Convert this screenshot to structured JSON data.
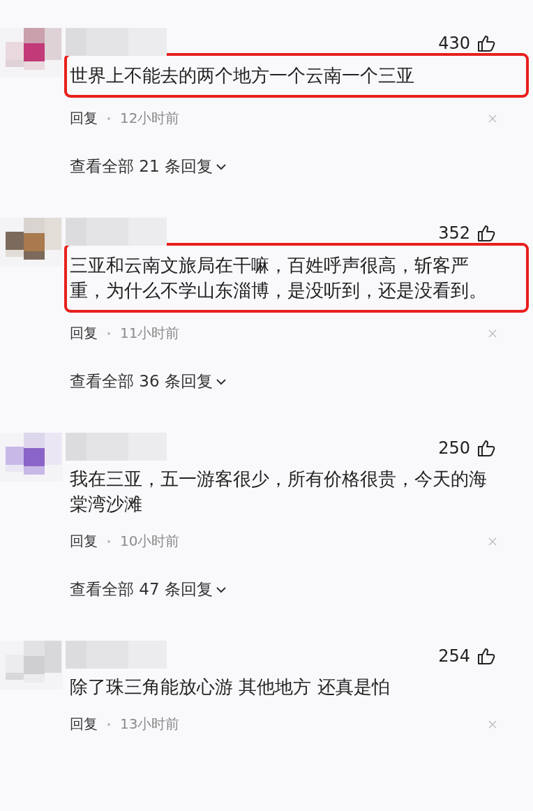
{
  "comments": [
    {
      "likes": "430",
      "text": "世界上不能去的两个地方一个云南一个三亚",
      "highlighted": true,
      "reply": "回复",
      "time": "12小时前",
      "view_all": "查看全部 21 条回复"
    },
    {
      "likes": "352",
      "text": "三亚和云南文旅局在干嘛，百姓呼声很高，斩客严重，为什么不学山东淄博，是没听到，还是没看到。",
      "highlighted": true,
      "reply": "回复",
      "time": "11小时前",
      "view_all": "查看全部 36 条回复"
    },
    {
      "likes": "250",
      "text": "我在三亚，五一游客很少，所有价格很贵，今天的海棠湾沙滩",
      "highlighted": false,
      "reply": "回复",
      "time": "10小时前",
      "view_all": "查看全部 47 条回复"
    },
    {
      "likes": "254",
      "text": "除了珠三角能放心游 其他地方 还真是怕",
      "highlighted": false,
      "reply": "回复",
      "time": "13小时前"
    }
  ]
}
